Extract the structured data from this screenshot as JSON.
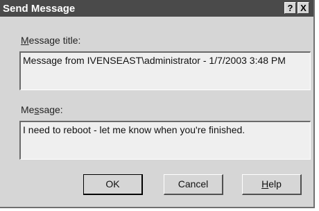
{
  "window": {
    "title": "Send Message",
    "help_button": "?",
    "close_button": "X"
  },
  "message_title": {
    "label_prefix": "",
    "label_accel": "M",
    "label_rest": "essage title:",
    "value": "Message from IVENSEAST\\administrator - 1/7/2003 3:48 PM"
  },
  "message": {
    "label_prefix": "Me",
    "label_accel": "s",
    "label_rest": "sage:",
    "value": "I need to reboot - let me know when you're finished."
  },
  "buttons": {
    "ok": "OK",
    "cancel": "Cancel",
    "help_accel": "H",
    "help_rest": "elp"
  },
  "colors": {
    "titlebar": "#4a4a4a",
    "dialog": "#d6d6d6",
    "field": "#efefef"
  }
}
